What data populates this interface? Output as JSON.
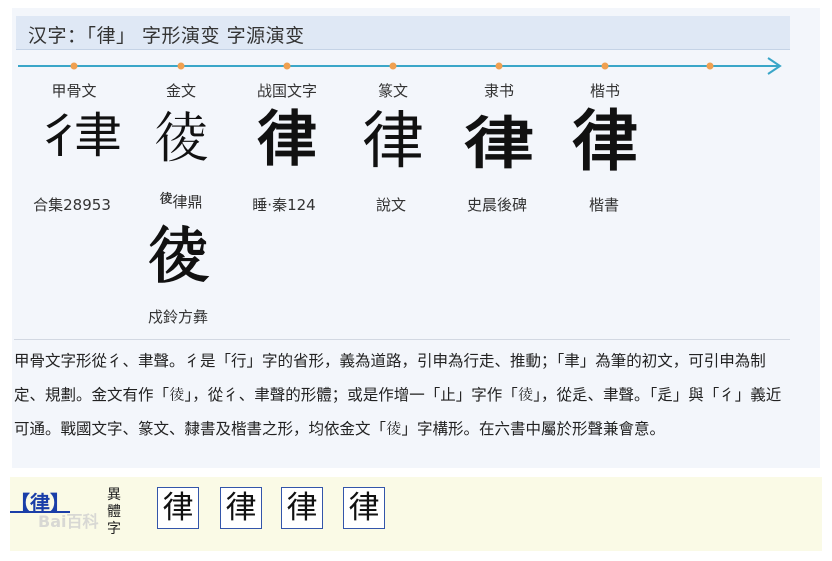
{
  "title": "汉字：「律」 字形演变 字源演变",
  "eras": [
    {
      "label": "甲骨文",
      "glyph": "彳聿",
      "source": "合集28953"
    },
    {
      "label": "金文",
      "glyph": "𢔁",
      "source": "律鼎",
      "source_mark": "𢔁"
    },
    {
      "label": "战国文字",
      "glyph": "律",
      "source": "睡·秦124"
    },
    {
      "label": "篆文",
      "glyph": "律",
      "source": "說文"
    },
    {
      "label": "隶书",
      "glyph": "律",
      "source": "史晨後碑"
    },
    {
      "label": "楷书",
      "glyph": "律",
      "source": "楷書"
    }
  ],
  "extra": {
    "glyph": "𢔁",
    "source": "戍鈴方彝"
  },
  "description": "甲骨文字形從彳、聿聲。彳是「行」字的省形，義為道路，引申為行走、推動；「聿」為筆的初文，可引申為制定、規劃。金文有作「𢔁」，從彳、聿聲的形體；或是作增一「止」字作「𢔁」，從辵、聿聲。「辵」與「彳」義近可通。戰國文字、篆文、隸書及楷書之形，均依金文「𢔁」字構形。在六書中屬於形聲兼會意。",
  "variants": {
    "head": "【律】",
    "tag": "異體字",
    "chars": [
      "律",
      "律",
      "律",
      "律"
    ]
  },
  "watermark": "Bai百科",
  "colors": {
    "accent": "#3aa6c8",
    "dot": "#f0a050",
    "link": "#1a3ea8"
  }
}
